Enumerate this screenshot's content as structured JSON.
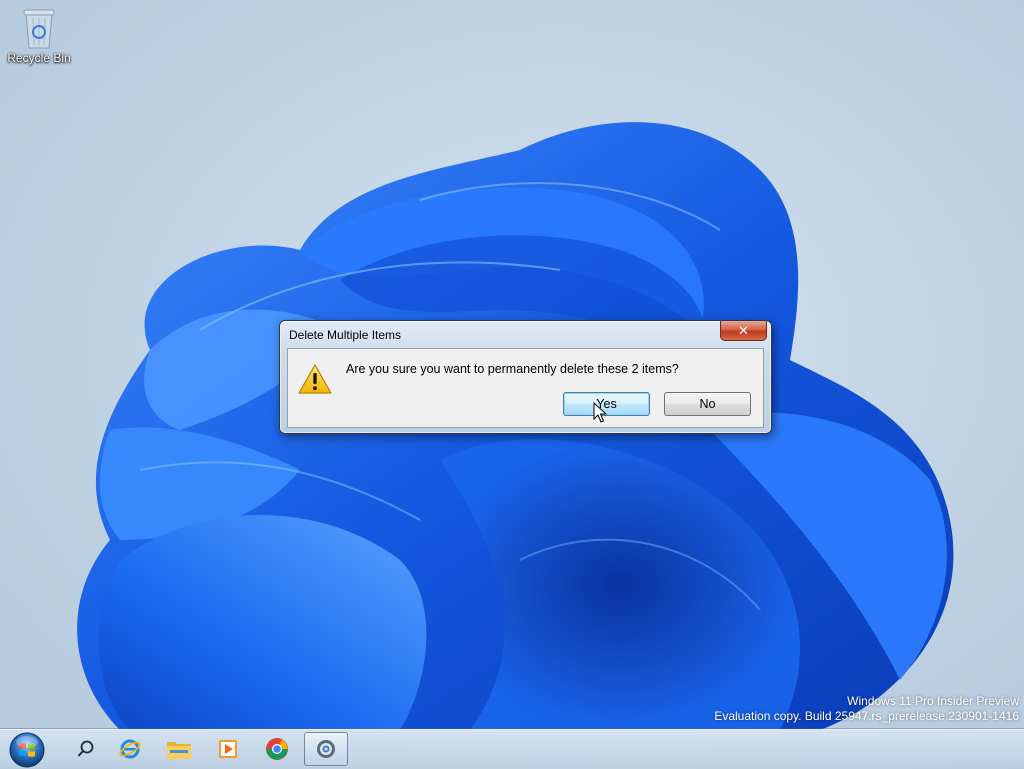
{
  "desktop": {
    "recycle_bin_label": "Recycle Bin"
  },
  "watermark": {
    "line1": "Windows 11 Pro Insider Preview",
    "line2": "Evaluation copy. Build 25947.rs_prerelease.230901-1416"
  },
  "dialog": {
    "title": "Delete Multiple Items",
    "close_label": "✕",
    "message": "Are you sure you want to permanently delete these 2 items?",
    "yes_label": "Yes",
    "no_label": "No",
    "icon": "warning-icon"
  },
  "taskbar": {
    "items": [
      "start-orb",
      "search-icon",
      "internet-explorer-icon",
      "file-explorer-icon",
      "media-player-icon",
      "chrome-icon",
      "settings-icon"
    ],
    "active_item": "settings-icon"
  },
  "colors": {
    "wallpaper_bloom": "#1a6ef0",
    "default_button_border": "#3c7fb1",
    "close_button": "#c0391f"
  }
}
